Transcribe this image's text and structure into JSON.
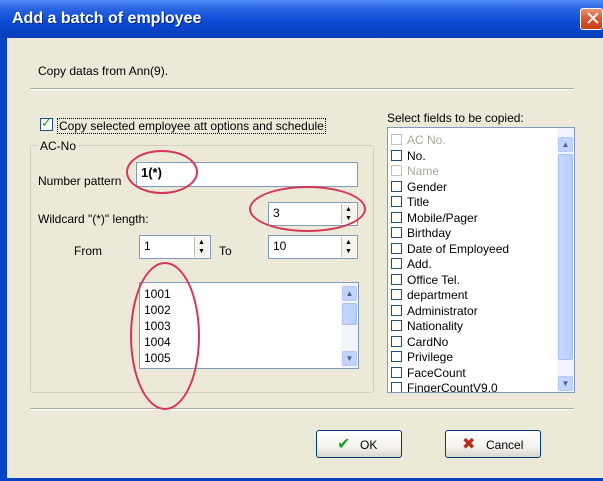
{
  "window": {
    "title": "Add a batch of employee",
    "close_glyph": "✕"
  },
  "info": {
    "text": "Copy datas from Ann(9)."
  },
  "copy_options": {
    "checked": true,
    "label": "Copy selected employee att options and schedule"
  },
  "acno": {
    "legend": "AC-No",
    "number_pattern_label": "Number pattern",
    "number_pattern_value": "1(*)",
    "wildcard_label": "Wildcard \"(*)\" length:",
    "wildcard_value": "3",
    "from_label": "From",
    "from_value": "1",
    "to_label": "To",
    "to_value": "10",
    "numbers": [
      "1001",
      "1002",
      "1003",
      "1004",
      "1005"
    ]
  },
  "fields": {
    "label": "Select fields to be copied:",
    "items": [
      {
        "label": "AC No.",
        "enabled": false
      },
      {
        "label": "No.",
        "enabled": true
      },
      {
        "label": "Name",
        "enabled": false
      },
      {
        "label": "Gender",
        "enabled": true
      },
      {
        "label": "Title",
        "enabled": true
      },
      {
        "label": "Mobile/Pager",
        "enabled": true
      },
      {
        "label": "Birthday",
        "enabled": true
      },
      {
        "label": "Date of Employeed",
        "enabled": true
      },
      {
        "label": "Add.",
        "enabled": true
      },
      {
        "label": "Office Tel.",
        "enabled": true
      },
      {
        "label": "department",
        "enabled": true
      },
      {
        "label": "Administrator",
        "enabled": true
      },
      {
        "label": "Nationality",
        "enabled": true
      },
      {
        "label": "CardNo",
        "enabled": true
      },
      {
        "label": "Privilege",
        "enabled": true
      },
      {
        "label": "FaceCount",
        "enabled": true
      },
      {
        "label": "FingerCountV9.0",
        "enabled": true
      }
    ]
  },
  "buttons": {
    "ok_label": "OK",
    "cancel_label": "Cancel"
  },
  "icons": {
    "check": "check-icon",
    "cancel": "x-icon",
    "spin_up": "triangle-up-icon",
    "spin_down": "triangle-down-icon",
    "scroll_up": "chevron-up-icon",
    "scroll_down": "chevron-down-icon"
  },
  "colors": {
    "title_bar": "#0a43c6",
    "annotation": "#d4365a",
    "ok_check": "#21a121",
    "cancel_x": "#c0281a"
  }
}
